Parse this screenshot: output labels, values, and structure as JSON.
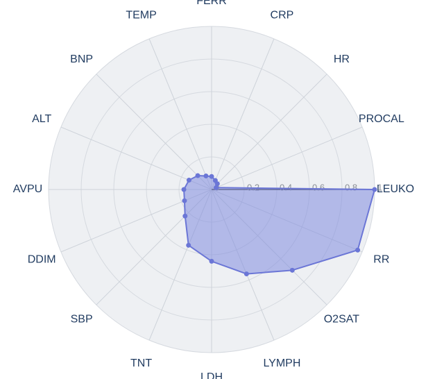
{
  "chart_data": {
    "type": "radar",
    "title": "",
    "categories": [
      "LEUKO",
      "RR",
      "O2SAT",
      "LYMPH",
      "LDH",
      "TNT",
      "SBP",
      "DDIM",
      "AVPU",
      "ALT",
      "BNP",
      "TEMP",
      "FERR",
      "CRP",
      "HR",
      "PROCAL"
    ],
    "values": [
      1.0,
      0.97,
      0.7,
      0.56,
      0.44,
      0.37,
      0.23,
      0.18,
      0.17,
      0.15,
      0.12,
      0.09,
      0.08,
      0.06,
      0.05,
      0.03
    ],
    "rlim": [
      0,
      1
    ],
    "ticks": [
      0,
      0.2,
      0.4,
      0.6,
      0.8,
      1
    ],
    "grid": true,
    "legend": false,
    "colors": {
      "series_fill": "#828cde",
      "series_line": "#6b76d6",
      "grid_bg": "#eef0f3",
      "grid_line": "#d5d9df",
      "axis_label": "#1f3a5f"
    }
  },
  "tick_labels": {
    "t0": "0",
    "t1": "0.2",
    "t2": "0.4",
    "t3": "0.6",
    "t4": "0.8",
    "t5": "1"
  },
  "axis_labels": {
    "a0": "LEUKO",
    "a1": "RR",
    "a2": "O2SAT",
    "a3": "LYMPH",
    "a4": "LDH",
    "a5": "TNT",
    "a6": "SBP",
    "a7": "DDIM",
    "a8": "AVPU",
    "a9": "ALT",
    "a10": "BNP",
    "a11": "TEMP",
    "a12": "FERR",
    "a13": "CRP",
    "a14": "HR",
    "a15": "PROCAL"
  }
}
